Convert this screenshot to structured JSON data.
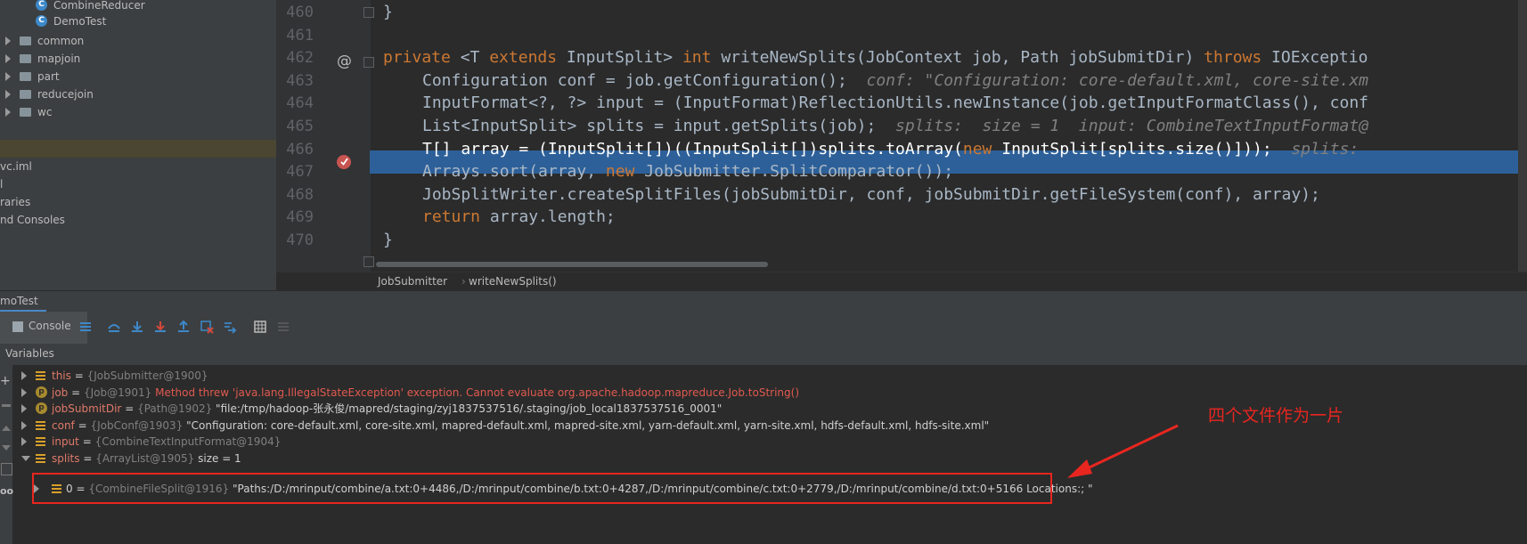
{
  "project_tree": {
    "items": [
      {
        "label": "CombineReducer",
        "kind": "class"
      },
      {
        "label": "DemoTest",
        "kind": "class"
      },
      {
        "label": "common",
        "kind": "folder"
      },
      {
        "label": "mapjoin",
        "kind": "folder"
      },
      {
        "label": "part",
        "kind": "folder"
      },
      {
        "label": "reducejoin",
        "kind": "folder"
      },
      {
        "label": "wc",
        "kind": "folder"
      }
    ],
    "extra": [
      "vc.iml",
      "l",
      "raries",
      "nd Consoles"
    ]
  },
  "editor": {
    "lines": [
      {
        "num": "460",
        "parts": [
          {
            "t": "}",
            "c": ""
          }
        ]
      },
      {
        "num": "461",
        "parts": []
      },
      {
        "num": "462",
        "parts": [
          {
            "t": "private ",
            "c": "kw"
          },
          {
            "t": "<T ",
            "c": ""
          },
          {
            "t": "extends ",
            "c": "kw"
          },
          {
            "t": "InputSplit> ",
            "c": ""
          },
          {
            "t": "int ",
            "c": "kw"
          },
          {
            "t": "writeNewSplits(JobContext job, Path jobSubmitDir) ",
            "c": ""
          },
          {
            "t": "throws ",
            "c": "kw"
          },
          {
            "t": "IOExceptio",
            "c": ""
          }
        ]
      },
      {
        "num": "463",
        "parts": [
          {
            "t": "Configuration conf = job.getConfiguration();  ",
            "c": ""
          },
          {
            "t": "conf: \"Configuration: core-default.xml, core-site.xm",
            "c": "cm"
          }
        ]
      },
      {
        "num": "464",
        "parts": [
          {
            "t": "InputFormat<?, ?> input = (InputFormat)ReflectionUtils.newInstance(job.getInputFormatClass(), conf",
            "c": ""
          }
        ]
      },
      {
        "num": "465",
        "parts": [
          {
            "t": "List<InputSplit> splits = input.getSplits(job);  ",
            "c": ""
          },
          {
            "t": "splits:  size = 1  input: CombineTextInputFormat@",
            "c": "cm"
          }
        ]
      },
      {
        "num": "466",
        "parts": [
          {
            "t": "T[] array = (InputSplit[])((InputSplit[])splits.toArray(",
            "c": ""
          },
          {
            "t": "new ",
            "c": "kw"
          },
          {
            "t": "InputSplit[splits.size()]));  ",
            "c": ""
          },
          {
            "t": "splits: ",
            "c": "cm"
          }
        ]
      },
      {
        "num": "467",
        "parts": [
          {
            "t": "Arrays.sort(array, ",
            "c": ""
          },
          {
            "t": "new ",
            "c": "kw"
          },
          {
            "t": "JobSubmitter.SplitComparator());",
            "c": ""
          }
        ]
      },
      {
        "num": "468",
        "parts": [
          {
            "t": "JobSplitWriter.createSplitFiles(jobSubmitDir, conf, jobSubmitDir.getFileSystem(conf), array);",
            "c": ""
          }
        ]
      },
      {
        "num": "469",
        "parts": [
          {
            "t": "return ",
            "c": "kw"
          },
          {
            "t": "array.length;",
            "c": ""
          }
        ]
      },
      {
        "num": "470",
        "parts": [
          {
            "t": "}",
            "c": ""
          }
        ]
      }
    ],
    "breadcrumb": [
      "JobSubmitter",
      "writeNewSplits()"
    ]
  },
  "debug": {
    "tab_title": "moTest",
    "console_label": "Console",
    "variables_label": "Variables",
    "variables": [
      {
        "name": "this",
        "eq": " = ",
        "type": "{JobSubmitter@1900}",
        "value": "",
        "icon": "field",
        "arrow": "right"
      },
      {
        "name": "job",
        "eq": " = ",
        "type": "{Job@1901} ",
        "value": "Method threw 'java.lang.IllegalStateException' exception. Cannot evaluate org.apache.hadoop.mapreduce.Job.toString()",
        "icon": "param",
        "arrow": "right",
        "error": true
      },
      {
        "name": "jobSubmitDir",
        "eq": " = ",
        "type": "{Path@1902} ",
        "value": "\"file:/tmp/hadoop-张永俊/mapred/staging/zyj1837537516/.staging/job_local1837537516_0001\"",
        "icon": "param",
        "arrow": "right"
      },
      {
        "name": "conf",
        "eq": " = ",
        "type": "{JobConf@1903} ",
        "value": "\"Configuration: core-default.xml, core-site.xml, mapred-default.xml, mapred-site.xml, yarn-default.xml, yarn-site.xml, hdfs-default.xml, hdfs-site.xml\"",
        "icon": "field",
        "arrow": "right"
      },
      {
        "name": "input",
        "eq": " = ",
        "type": "{CombineTextInputFormat@1904}",
        "value": "",
        "icon": "field",
        "arrow": "right"
      },
      {
        "name": "splits",
        "eq": " = ",
        "type": "{ArrayList@1905} ",
        "value": " size = 1",
        "icon": "field",
        "arrow": "down"
      }
    ],
    "child": {
      "name": "0",
      "eq": " = ",
      "type": "{CombineFileSplit@1916} ",
      "value": "\"Paths:/D:/mrinput/combine/a.txt:0+4486,/D:/mrinput/combine/b.txt:0+4287,/D:/mrinput/combine/c.txt:0+2779,/D:/mrinput/combine/d.txt:0+5166 Locations:; \""
    }
  },
  "annotation": {
    "text": "四个文件作为一片",
    "color": "#e8261f"
  }
}
